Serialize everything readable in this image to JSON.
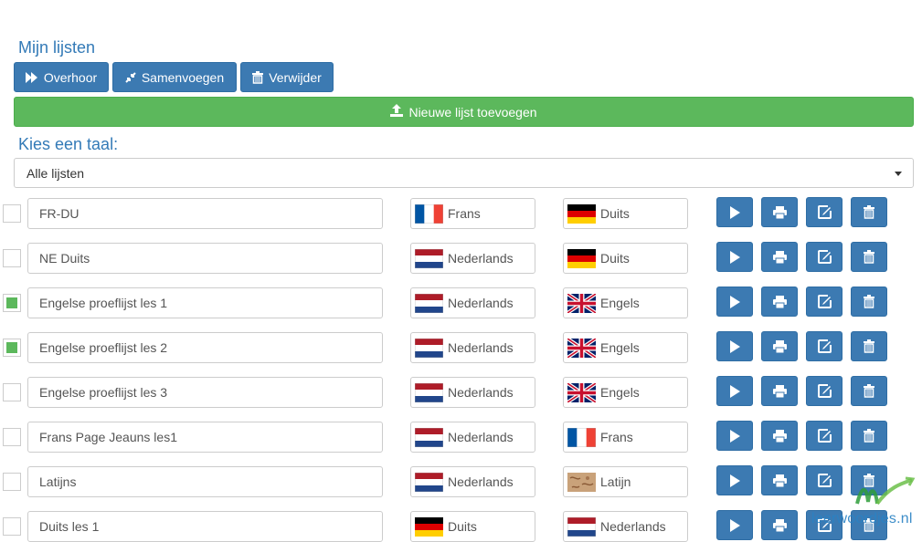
{
  "page": {
    "title": "Mijn lijsten",
    "lang_title": "Kies een taal:"
  },
  "toolbar": {
    "overhoor_label": "Overhoor",
    "samenvoegen_label": "Samenvoegen",
    "verwijder_label": "Verwijder",
    "new_list_label": "Nieuwe lijst toevoegen"
  },
  "filter": {
    "selected": "Alle lijsten"
  },
  "lists": [
    {
      "name": "FR-DU",
      "checked": false,
      "from": {
        "label": "Frans",
        "flag": "fr"
      },
      "to": {
        "label": "Duits",
        "flag": "de"
      }
    },
    {
      "name": "NE Duits",
      "checked": false,
      "from": {
        "label": "Nederlands",
        "flag": "nl"
      },
      "to": {
        "label": "Duits",
        "flag": "de"
      }
    },
    {
      "name": "Engelse proeflijst les 1",
      "checked": true,
      "from": {
        "label": "Nederlands",
        "flag": "nl"
      },
      "to": {
        "label": "Engels",
        "flag": "uk"
      }
    },
    {
      "name": "Engelse proeflijst les 2",
      "checked": true,
      "from": {
        "label": "Nederlands",
        "flag": "nl"
      },
      "to": {
        "label": "Engels",
        "flag": "uk"
      }
    },
    {
      "name": "Engelse proeflijst les 3",
      "checked": false,
      "from": {
        "label": "Nederlands",
        "flag": "nl"
      },
      "to": {
        "label": "Engels",
        "flag": "uk"
      }
    },
    {
      "name": "Frans Page Jeauns les1",
      "checked": false,
      "from": {
        "label": "Nederlands",
        "flag": "nl"
      },
      "to": {
        "label": "Frans",
        "flag": "fr"
      }
    },
    {
      "name": "Latijns",
      "checked": false,
      "from": {
        "label": "Nederlands",
        "flag": "nl"
      },
      "to": {
        "label": "Latijn",
        "flag": "la"
      }
    },
    {
      "name": "Duits les 1",
      "checked": false,
      "from": {
        "label": "Duits",
        "flag": "de"
      },
      "to": {
        "label": "Nederlands",
        "flag": "nl"
      }
    }
  ],
  "logo": {
    "text": "leerwoordjes.nl"
  },
  "colors": {
    "primary": "#3c7ab2",
    "success": "#5cb85c",
    "heading": "#337ab7"
  }
}
